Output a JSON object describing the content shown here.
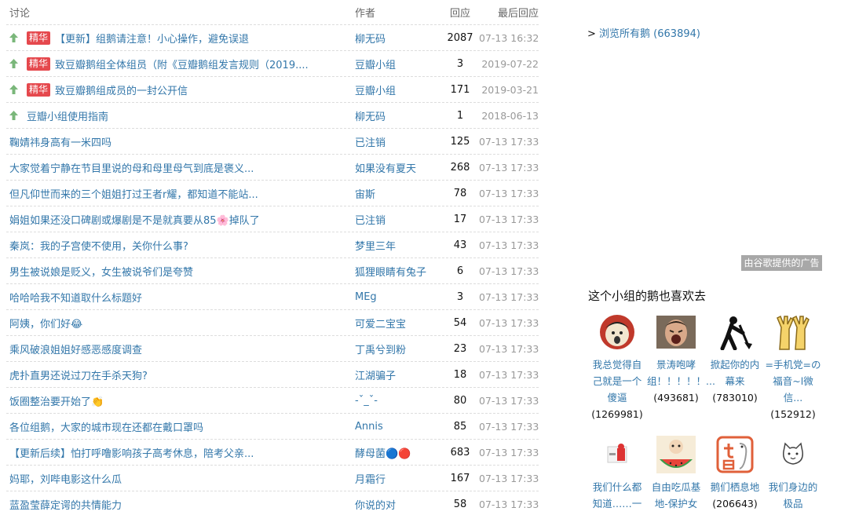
{
  "header": {
    "col_title": "讨论",
    "col_author": "作者",
    "col_replies": "回应",
    "col_last": "最后回应"
  },
  "topics": [
    {
      "pinned": true,
      "badge": "精华",
      "title": "【更新】组鹅请注意！小心操作，避免误退",
      "author": "柳无码",
      "replies": "2087",
      "last": "07-13 16:32"
    },
    {
      "pinned": true,
      "badge": "精华",
      "title": "致豆瓣鹅组全体组员（附《豆瓣鹅组发言规则（2019....",
      "author": "豆瓣小组",
      "replies": "3",
      "last": "2019-07-22"
    },
    {
      "pinned": true,
      "badge": "精华",
      "title": "致豆瓣鹅组成员的一封公开信",
      "author": "豆瓣小组",
      "replies": "171",
      "last": "2019-03-21"
    },
    {
      "pinned": true,
      "badge": "",
      "title": "豆瓣小组使用指南",
      "author": "柳无码",
      "replies": "1",
      "last": "2018-06-13"
    },
    {
      "pinned": false,
      "badge": "",
      "title": "鞠婧祎身高有一米四吗",
      "author": "已注销",
      "replies": "125",
      "last": "07-13 17:33"
    },
    {
      "pinned": false,
      "badge": "",
      "title": "大家觉着宁静在节目里说的母和母里母气到底是褒义...",
      "author": "如果没有夏天",
      "replies": "268",
      "last": "07-13 17:33"
    },
    {
      "pinned": false,
      "badge": "",
      "title": "但凡仰世而来的三个姐姐打过王者r耀，都知道不能站...",
      "author": "宙斯",
      "replies": "78",
      "last": "07-13 17:33"
    },
    {
      "pinned": false,
      "badge": "",
      "title": "娟姐如果还没口碑剧或爆剧是不是就真要从85🌸掉队了",
      "author": "已注销",
      "replies": "17",
      "last": "07-13 17:33"
    },
    {
      "pinned": false,
      "badge": "",
      "title": "秦岚：我的子宫使不使用，关你什么事?",
      "author": "梦里三年",
      "replies": "43",
      "last": "07-13 17:33"
    },
    {
      "pinned": false,
      "badge": "",
      "title": "男生被说娘是贬义，女生被说爷们是夸赞",
      "author": "狐狸眼睛有兔子",
      "replies": "6",
      "last": "07-13 17:33"
    },
    {
      "pinned": false,
      "badge": "",
      "title": "哈哈哈我不知道取什么标题好",
      "author": "MEg",
      "replies": "3",
      "last": "07-13 17:33"
    },
    {
      "pinned": false,
      "badge": "",
      "title": "阿姨，你们好😂",
      "author": "可爱二宝宝",
      "replies": "54",
      "last": "07-13 17:33"
    },
    {
      "pinned": false,
      "badge": "",
      "title": "乘风破浪姐姐好感恶感度调查",
      "author": "丁禹兮到粉",
      "replies": "23",
      "last": "07-13 17:33"
    },
    {
      "pinned": false,
      "badge": "",
      "title": "虎扑直男还说过刀在手杀天狗?",
      "author": "江湖骗子",
      "replies": "18",
      "last": "07-13 17:33"
    },
    {
      "pinned": false,
      "badge": "",
      "title": "饭圈整治要开始了👏",
      "author": "-ˇ_ˇ-",
      "replies": "80",
      "last": "07-13 17:33"
    },
    {
      "pinned": false,
      "badge": "",
      "title": "各位组鹅，大家的城市现在还都在戴口罩吗",
      "author": "Annis",
      "replies": "85",
      "last": "07-13 17:33"
    },
    {
      "pinned": false,
      "badge": "",
      "title": "【更新后续】怕打呼噜影响孩子高考休息，陪考父亲...",
      "author": "酵母菌🔵🔴",
      "replies": "683",
      "last": "07-13 17:33"
    },
    {
      "pinned": false,
      "badge": "",
      "title": "妈耶，刘哔电影这什么瓜",
      "author": "月霜行",
      "replies": "167",
      "last": "07-13 17:33"
    },
    {
      "pinned": false,
      "badge": "",
      "title": "蓝盈莹薛定谔的共情能力",
      "author": "你说的对",
      "replies": "58",
      "last": "07-13 17:33"
    }
  ],
  "sidebar": {
    "browse_prefix": ">",
    "browse_all": "浏览所有鹅 (663894)",
    "ad_label": "由谷歌提供的广告",
    "related_title": "这个小组的鹅也喜欢去",
    "groups": [
      {
        "name": "我总觉得自己就是一个傻逼",
        "count": "(1269981)",
        "icon": "screaming-face-avatar"
      },
      {
        "name": "景涛咆哮组！！！！！...",
        "count": "(493681)",
        "icon": "shouting-man-avatar"
      },
      {
        "name": "掀起你的内幕来",
        "count": "(783010)",
        "icon": "digging-man-avatar"
      },
      {
        "name": "=手机党=の福音~l微信...",
        "count": "(152912)",
        "icon": "raised-hands-avatar"
      },
      {
        "name": "我们什么都知道……一",
        "count": "",
        "icon": "red-figure-avatar"
      },
      {
        "name": "自由吃瓜基地-保护女",
        "count": "",
        "icon": "watermelon-avatar"
      },
      {
        "name": "鹅们栖息地",
        "count": "(206643)",
        "icon": "qizu-logo-avatar"
      },
      {
        "name": "我们身边的极品",
        "count": "",
        "icon": "cat-face-avatar"
      }
    ]
  },
  "colors": {
    "link": "#3377aa",
    "badge": "#e5484d",
    "pin": "#7ab77a",
    "muted": "#999999"
  }
}
